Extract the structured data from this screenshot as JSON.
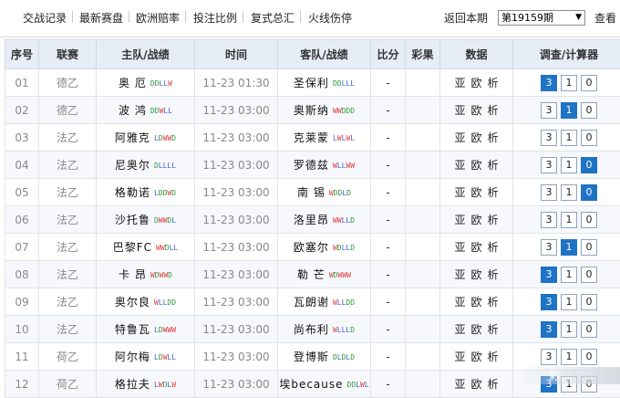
{
  "nav": {
    "items": [
      "交战记录",
      "最新赛盘",
      "欧洲赔率",
      "投注比例",
      "复式总汇",
      "火线伤停"
    ],
    "return_label": "返回本期",
    "period_selected": "第19159期",
    "view_label": "查看"
  },
  "table": {
    "headers": [
      "序号",
      "联赛",
      "主队/战绩",
      "时间",
      "客队/战绩",
      "比分",
      "彩果",
      "数据",
      "调查/计算器"
    ],
    "data_links": [
      "亚",
      "欧",
      "析"
    ],
    "calc_values": [
      "3",
      "1",
      "0"
    ],
    "rows": [
      {
        "no": "01",
        "league": "德乙",
        "home": "奥 厄",
        "home_form": "DDLLW",
        "time": "11-23 01:30",
        "away": "圣保利",
        "away_form": "DDLLL",
        "score": "-",
        "selected": "3"
      },
      {
        "no": "02",
        "league": "德乙",
        "home": "波 鸿",
        "home_form": "DDWLL",
        "time": "11-23 03:00",
        "away": "奥斯纳",
        "away_form": "WWDDD",
        "score": "-",
        "selected": "1"
      },
      {
        "no": "03",
        "league": "法乙",
        "home": "阿雅克",
        "home_form": "LDWWD",
        "time": "11-23 03:00",
        "away": "克莱蒙",
        "away_form": "LWLWL",
        "score": "-",
        "selected": ""
      },
      {
        "no": "04",
        "league": "法乙",
        "home": "尼奥尔",
        "home_form": "DLLLL",
        "time": "11-23 03:00",
        "away": "罗德兹",
        "away_form": "WLLWW",
        "score": "-",
        "selected": "0"
      },
      {
        "no": "05",
        "league": "法乙",
        "home": "格勒诺",
        "home_form": "LDDWD",
        "time": "11-23 03:00",
        "away": "南 锡",
        "away_form": "WDDLD",
        "score": "-",
        "selected": "0"
      },
      {
        "no": "06",
        "league": "法乙",
        "home": "沙托鲁",
        "home_form": "DWWDL",
        "time": "11-23 03:00",
        "away": "洛里昂",
        "away_form": "WWLLD",
        "score": "-",
        "selected": ""
      },
      {
        "no": "07",
        "league": "法乙",
        "home": "巴黎FC",
        "home_form": "WWDLL",
        "time": "11-23 03:00",
        "away": "欧塞尔",
        "away_form": "WDLLD",
        "score": "-",
        "selected": "1"
      },
      {
        "no": "08",
        "league": "法乙",
        "home": "卡 昂",
        "home_form": "WDWWD",
        "time": "11-23 03:00",
        "away": "勒 芒",
        "away_form": "WDWWW",
        "score": "-",
        "selected": "3"
      },
      {
        "no": "09",
        "league": "法乙",
        "home": "奥尔良",
        "home_form": "WLLDD",
        "time": "11-23 03:00",
        "away": "瓦朗谢",
        "away_form": "WLLDD",
        "score": "-",
        "selected": "3"
      },
      {
        "no": "10",
        "league": "法乙",
        "home": "特鲁瓦",
        "home_form": "LDWWW",
        "time": "11-23 03:00",
        "away": "尚布利",
        "away_form": "WLLLD",
        "score": "-",
        "selected": "3"
      },
      {
        "no": "11",
        "league": "荷乙",
        "home": "阿尔梅",
        "home_form": "LDWLL",
        "time": "11-23 03:00",
        "away": "登博斯",
        "away_form": "DLDLD",
        "score": "-",
        "selected": ""
      },
      {
        "no": "12",
        "league": "荷乙",
        "home": "格拉夫",
        "home_form": "LWDLW",
        "time": "11-23 03:00",
        "away": "埃because",
        "away_form": "DDLWL",
        "score": "-",
        "selected": "3"
      }
    ]
  },
  "colors": {
    "header_bg": "#e6edf6",
    "selected_box": "#1f73c4",
    "form_win": "#e03a3a",
    "form_draw": "#2c9a3a",
    "form_loss": "#3a5fc8"
  }
}
